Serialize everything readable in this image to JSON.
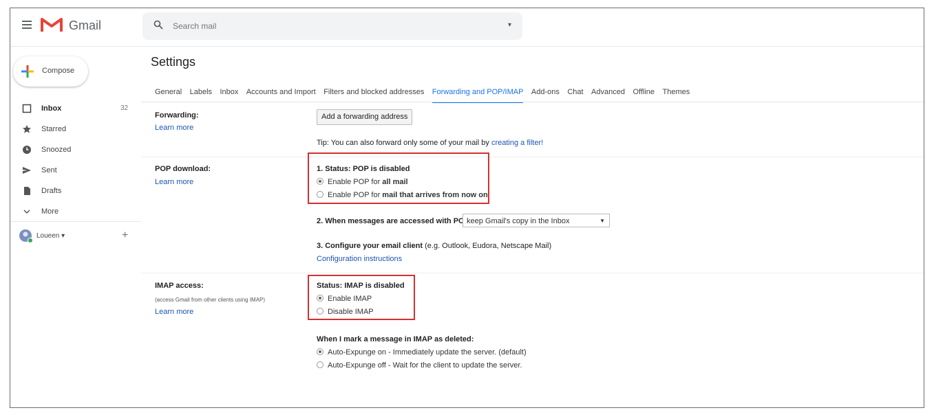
{
  "brand": "Gmail",
  "search": {
    "placeholder": "Search mail"
  },
  "compose_label": "Compose",
  "nav": [
    {
      "label": "Inbox",
      "count": "32",
      "icon": "inbox-icon"
    },
    {
      "label": "Starred",
      "count": "",
      "icon": "star-icon"
    },
    {
      "label": "Snoozed",
      "count": "",
      "icon": "clock-icon"
    },
    {
      "label": "Sent",
      "count": "",
      "icon": "send-icon"
    },
    {
      "label": "Drafts",
      "count": "",
      "icon": "draft-icon"
    },
    {
      "label": "More",
      "count": "",
      "icon": "chevron-down-icon"
    }
  ],
  "user": {
    "name": "Loueen"
  },
  "settings_title": "Settings",
  "tabs": [
    "General",
    "Labels",
    "Inbox",
    "Accounts and Import",
    "Filters and blocked addresses",
    "Forwarding and POP/IMAP",
    "Add-ons",
    "Chat",
    "Advanced",
    "Offline",
    "Themes"
  ],
  "active_tab": "Forwarding and POP/IMAP",
  "forwarding": {
    "label": "Forwarding:",
    "learn_more": "Learn more",
    "button": "Add a forwarding address",
    "tip": "Tip: You can also forward only some of your mail by",
    "tip_link": "creating a filter!"
  },
  "pop": {
    "label": "POP download:",
    "learn_more": "Learn more",
    "status": "1. Status: POP is disabled",
    "opt1_prefix": "Enable POP for",
    "opt1_bold": "all mail",
    "opt2_prefix": "Enable POP for",
    "opt2_bold": "mail that arrives from now on",
    "step2": "2. When messages are accessed with POP",
    "step2_select": "keep Gmail's copy in the Inbox",
    "step3_bold": "3. Configure your email client",
    "step3_rest": "(e.g. Outlook, Eudora, Netscape Mail)",
    "config_link": "Configuration instructions"
  },
  "imap": {
    "label": "IMAP access:",
    "sub": "(access Gmail from other clients using IMAP)",
    "learn_more": "Learn more",
    "status": "Status: IMAP is disabled",
    "enable": "Enable IMAP",
    "disable": "Disable IMAP",
    "deleted_heading": "When I mark a message in IMAP as deleted:",
    "expunge_on": "Auto-Expunge on - Immediately update the server. (default)",
    "expunge_off": "Auto-Expunge off - Wait for the client to update the server."
  },
  "colors": {
    "accent": "#1a73e8",
    "highlight": "#d32f2f",
    "link": "#1a55b0"
  }
}
